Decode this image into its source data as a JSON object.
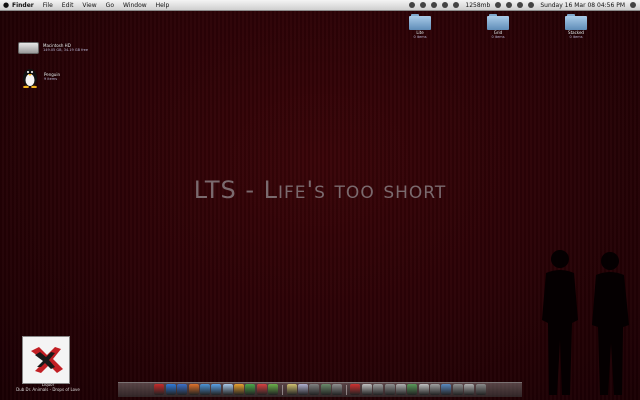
{
  "menubar": {
    "apple": "",
    "items": [
      "Finder",
      "File",
      "Edit",
      "View",
      "Go",
      "Window",
      "Help"
    ],
    "status": {
      "memory": "1258mb",
      "clock": "Sunday 16 Mar 08  04:56 PM"
    }
  },
  "desktop_folders": [
    {
      "label": "Lite",
      "sub": "0 items"
    },
    {
      "label": "Grid",
      "sub": "0 items"
    },
    {
      "label": "Stacked",
      "sub": "0 items"
    }
  ],
  "desktop_drives": [
    {
      "label": "Macintosh HD",
      "sub": "149.05 GB, 34.19 GB free"
    },
    {
      "label": "Penguin",
      "sub": "9 items"
    }
  ],
  "headline": "LTS - Life's too short",
  "album": {
    "line1": "Liquor",
    "line2": "Dub Dr. Animals - Drops of Love"
  },
  "dock": {
    "left_colors": [
      "#c62a2a",
      "#2f7ad9",
      "#3b6fc9",
      "#e0712a",
      "#4b93d6",
      "#5ba0e6",
      "#a7c7e8",
      "#e8a030",
      "#4aa84a",
      "#d84040",
      "#6ab04a"
    ],
    "mid_colors": [
      "#d0c070",
      "#b0b0d0",
      "#808080",
      "#6a8a6a",
      "#909090"
    ],
    "right_colors": [
      "#d03030",
      "#c0c0c0",
      "#a0a0a0",
      "#909090",
      "#b0b0b0",
      "#5a9a5a",
      "#c0c0c0",
      "#a0a0a0",
      "#5a8ac0",
      "#909090",
      "#b0b0b0",
      "#8a8a8a"
    ]
  }
}
